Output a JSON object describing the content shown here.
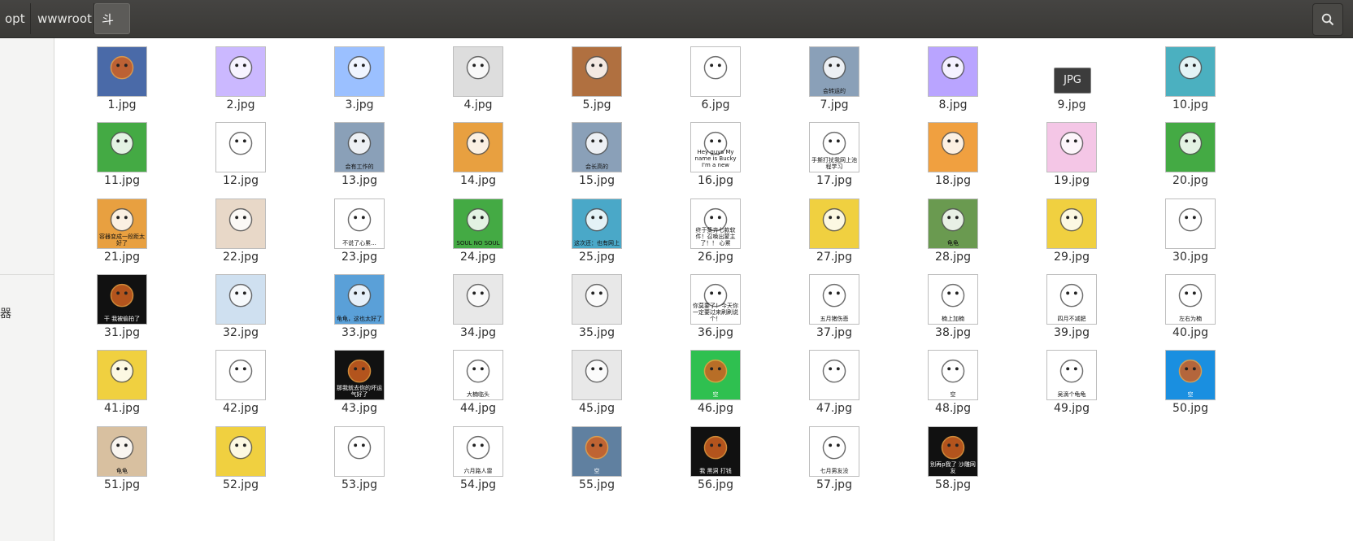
{
  "breadcrumb": {
    "items": [
      "opt",
      "wwwroot",
      "斗图"
    ]
  },
  "sidebar": {
    "fragment_text": "器"
  },
  "files": [
    {
      "name": "1.jpg",
      "color": "#4a6aa8",
      "icon": "cartoon-cat-icon"
    },
    {
      "name": "2.jpg",
      "color": "#cbb8ff",
      "icon": "bunny-rainbow-icon"
    },
    {
      "name": "3.jpg",
      "color": "#9bc0ff",
      "icon": "doodle-bunny-icon"
    },
    {
      "name": "4.jpg",
      "color": "#dddddd",
      "icon": "cat-face-icon"
    },
    {
      "name": "5.jpg",
      "color": "#b07040",
      "icon": "frog-icon"
    },
    {
      "name": "6.jpg",
      "color": "#ffffff",
      "icon": "cat-face-icon"
    },
    {
      "name": "7.jpg",
      "color": "#8aa0b8",
      "icon": "elephant-icon",
      "caption": "会转运的"
    },
    {
      "name": "8.jpg",
      "color": "#b9a4ff",
      "icon": "bunny-sparkle-icon"
    },
    {
      "name": "9.jpg",
      "color": "#3a3a3a",
      "icon": "jpg-generic-icon",
      "label": "JPG"
    },
    {
      "name": "10.jpg",
      "color": "#4bb0c0",
      "icon": "computer-icon"
    },
    {
      "name": "11.jpg",
      "color": "#44aa44",
      "icon": "frog-clown-icon"
    },
    {
      "name": "12.jpg",
      "color": "#ffffff",
      "icon": "sketch-face-icon"
    },
    {
      "name": "13.jpg",
      "color": "#8aa0b8",
      "icon": "elephant-icon",
      "caption": "会有工作的"
    },
    {
      "name": "14.jpg",
      "color": "#e8a040",
      "icon": "cartoon-cat-icon"
    },
    {
      "name": "15.jpg",
      "color": "#8aa0b8",
      "icon": "elephant-icon",
      "caption": "会长高的"
    },
    {
      "name": "16.jpg",
      "color": "#ffffff",
      "icon": "frog-hole-icon",
      "caption": "Hey guys My name is Bucky I'm a new meme."
    },
    {
      "name": "17.jpg",
      "color": "#ffffff",
      "icon": "panda-study-icon",
      "caption": "手撕打扰我网上池程学习"
    },
    {
      "name": "18.jpg",
      "color": "#f0a040",
      "icon": "cartoon-cat-icon"
    },
    {
      "name": "19.jpg",
      "color": "#f4c6e6",
      "icon": "bunny-hearts-icon"
    },
    {
      "name": "20.jpg",
      "color": "#44aa44",
      "icon": "frog-icon"
    },
    {
      "name": "21.jpg",
      "color": "#e8a040",
      "icon": "cartoon-cat-icon",
      "caption": "容器变成一段距太好了"
    },
    {
      "name": "22.jpg",
      "color": "#e8d8c8",
      "icon": "hair-face-icon"
    },
    {
      "name": "23.jpg",
      "color": "#ffffff",
      "icon": "panda-face-icon",
      "caption": "不说了心累..."
    },
    {
      "name": "24.jpg",
      "color": "#44aa44",
      "icon": "frog-soul-icon",
      "caption": "SOUL NO SOUL"
    },
    {
      "name": "25.jpg",
      "color": "#4aa8c8",
      "icon": "screen-icon",
      "caption": "这次还：也有网上"
    },
    {
      "name": "26.jpg",
      "color": "#ffffff",
      "icon": "crying-face-icon",
      "caption": "终于集齐七款软件！召唤出蒙主了！！ 心累"
    },
    {
      "name": "27.jpg",
      "color": "#f0d040",
      "icon": "duck-icon"
    },
    {
      "name": "28.jpg",
      "color": "#6a9a50",
      "icon": "turtle-icon",
      "caption": "龟龟"
    },
    {
      "name": "29.jpg",
      "color": "#f0d040",
      "icon": "duck-icon"
    },
    {
      "name": "30.jpg",
      "color": "#ffffff",
      "icon": "unicorn-icon"
    },
    {
      "name": "31.jpg",
      "color": "#111111",
      "icon": "black-hole-icon",
      "caption": "干 我被偷拍了"
    },
    {
      "name": "32.jpg",
      "color": "#cfe0f0",
      "icon": "figure-icon"
    },
    {
      "name": "33.jpg",
      "color": "#5aa0d8",
      "icon": "turtle-icon",
      "caption": "龟龟，这也太好了"
    },
    {
      "name": "34.jpg",
      "color": "#e8e8e8",
      "icon": "figure-icon"
    },
    {
      "name": "35.jpg",
      "color": "#e8e8e8",
      "icon": "figure-icon"
    },
    {
      "name": "36.jpg",
      "color": "#ffffff",
      "icon": "panda-face-icon",
      "caption": "你莫要了！今天你一定要过来刷刷说个！"
    },
    {
      "name": "37.jpg",
      "color": "#ffffff",
      "icon": "sketch-face-icon",
      "caption": "五月猪伤悲"
    },
    {
      "name": "38.jpg",
      "color": "#ffffff",
      "icon": "panda-face-icon",
      "caption": "楠上加楠"
    },
    {
      "name": "39.jpg",
      "color": "#ffffff",
      "icon": "sketch-face-icon",
      "caption": "四月不减肥"
    },
    {
      "name": "40.jpg",
      "color": "#ffffff",
      "icon": "panda-face-icon",
      "caption": "左右为楠"
    },
    {
      "name": "41.jpg",
      "color": "#f0d040",
      "icon": "duck-icon"
    },
    {
      "name": "42.jpg",
      "color": "#ffffff",
      "icon": "unicorn-icon"
    },
    {
      "name": "43.jpg",
      "color": "#111111",
      "icon": "black-hole-icon",
      "caption": "那我就去你的坏运气好了"
    },
    {
      "name": "44.jpg",
      "color": "#ffffff",
      "icon": "panda-face-icon",
      "caption": "大楠临头"
    },
    {
      "name": "45.jpg",
      "color": "#e8e8e8",
      "icon": "figure-icon"
    },
    {
      "name": "46.jpg",
      "color": "#2fc050",
      "icon": "wechat-icon",
      "caption": "空"
    },
    {
      "name": "47.jpg",
      "color": "#ffffff",
      "icon": "unicorn-icon"
    },
    {
      "name": "48.jpg",
      "color": "#ffffff",
      "icon": "wallet-icon",
      "caption": "空"
    },
    {
      "name": "49.jpg",
      "color": "#ffffff",
      "icon": "panda-face-icon",
      "caption": "吴滴个龟龟"
    },
    {
      "name": "50.jpg",
      "color": "#1a8fe0",
      "icon": "alipay-icon",
      "caption": "空"
    },
    {
      "name": "51.jpg",
      "color": "#d8c0a0",
      "icon": "cat-photo-icon",
      "caption": "龟龟"
    },
    {
      "name": "52.jpg",
      "color": "#f0d040",
      "icon": "duck-icon"
    },
    {
      "name": "53.jpg",
      "color": "#ffffff",
      "icon": "unicorn-icon"
    },
    {
      "name": "54.jpg",
      "color": "#ffffff",
      "icon": "sketch-face-icon",
      "caption": "六月路人雷"
    },
    {
      "name": "55.jpg",
      "color": "#6080a0",
      "icon": "cards-icon",
      "caption": "空"
    },
    {
      "name": "56.jpg",
      "color": "#111111",
      "icon": "black-hole-icon",
      "caption": "我 黑洞 打钱"
    },
    {
      "name": "57.jpg",
      "color": "#ffffff",
      "icon": "sketch-face-icon",
      "caption": "七月男友没"
    },
    {
      "name": "58.jpg",
      "color": "#111111",
      "icon": "black-hole-icon",
      "caption": "别再p我了 沙雕网友"
    }
  ]
}
